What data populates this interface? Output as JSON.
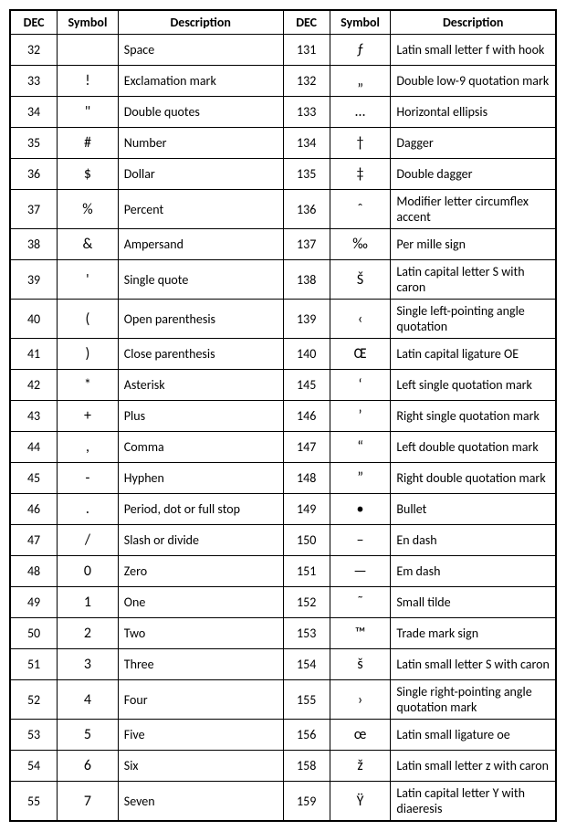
{
  "headers": {
    "dec": "DEC",
    "symbol": "Symbol",
    "description": "Description"
  },
  "rows": [
    {
      "l": {
        "dec": "32",
        "sym": "",
        "desc": "Space"
      },
      "r": {
        "dec": "131",
        "sym": "ƒ",
        "desc": "Latin small letter f with hook"
      }
    },
    {
      "l": {
        "dec": "33",
        "sym": "!",
        "desc": "Exclamation mark"
      },
      "r": {
        "dec": "132",
        "sym": "„",
        "desc": "Double low-9 quotation mark"
      }
    },
    {
      "l": {
        "dec": "34",
        "sym": "\"",
        "desc": "Double quotes"
      },
      "r": {
        "dec": "133",
        "sym": "…",
        "desc": "Horizontal ellipsis"
      }
    },
    {
      "l": {
        "dec": "35",
        "sym": "#",
        "desc": "Number"
      },
      "r": {
        "dec": "134",
        "sym": "†",
        "desc": "Dagger"
      }
    },
    {
      "l": {
        "dec": "36",
        "sym": "$",
        "desc": "Dollar"
      },
      "r": {
        "dec": "135",
        "sym": "‡",
        "desc": "Double dagger"
      }
    },
    {
      "l": {
        "dec": "37",
        "sym": "%",
        "desc": "Percent"
      },
      "r": {
        "dec": "136",
        "sym": "ˆ",
        "desc": "Modifier letter circumflex accent"
      }
    },
    {
      "l": {
        "dec": "38",
        "sym": "&",
        "desc": "Ampersand"
      },
      "r": {
        "dec": "137",
        "sym": "‰",
        "desc": "Per mille sign"
      }
    },
    {
      "l": {
        "dec": "39",
        "sym": "'",
        "desc": "Single quote"
      },
      "r": {
        "dec": "138",
        "sym": "Š",
        "desc": "Latin capital letter S with caron"
      }
    },
    {
      "l": {
        "dec": "40",
        "sym": "(",
        "desc": "Open parenthesis"
      },
      "r": {
        "dec": "139",
        "sym": "‹",
        "desc": "Single left-pointing angle quotation"
      }
    },
    {
      "l": {
        "dec": "41",
        "sym": ")",
        "desc": "Close parenthesis"
      },
      "r": {
        "dec": "140",
        "sym": "Œ",
        "desc": "Latin capital ligature OE"
      }
    },
    {
      "l": {
        "dec": "42",
        "sym": "*",
        "desc": "Asterisk"
      },
      "r": {
        "dec": "145",
        "sym": "‘",
        "desc": "Left single quotation mark"
      }
    },
    {
      "l": {
        "dec": "43",
        "sym": "+",
        "desc": "Plus"
      },
      "r": {
        "dec": "146",
        "sym": "’",
        "desc": "Right single quotation mark"
      }
    },
    {
      "l": {
        "dec": "44",
        "sym": ",",
        "desc": "Comma"
      },
      "r": {
        "dec": "147",
        "sym": "“",
        "desc": "Left double quotation mark"
      }
    },
    {
      "l": {
        "dec": "45",
        "sym": "-",
        "desc": "Hyphen"
      },
      "r": {
        "dec": "148",
        "sym": "”",
        "desc": "Right double quotation mark"
      }
    },
    {
      "l": {
        "dec": "46",
        "sym": ".",
        "desc": "Period, dot or full stop"
      },
      "r": {
        "dec": "149",
        "sym": "•",
        "desc": "Bullet"
      }
    },
    {
      "l": {
        "dec": "47",
        "sym": "/",
        "desc": "Slash or divide"
      },
      "r": {
        "dec": "150",
        "sym": "–",
        "desc": "En dash"
      }
    },
    {
      "l": {
        "dec": "48",
        "sym": "0",
        "desc": "Zero"
      },
      "r": {
        "dec": "151",
        "sym": "—",
        "desc": "Em dash"
      }
    },
    {
      "l": {
        "dec": "49",
        "sym": "1",
        "desc": "One"
      },
      "r": {
        "dec": "152",
        "sym": "˜",
        "desc": "Small tilde"
      }
    },
    {
      "l": {
        "dec": "50",
        "sym": "2",
        "desc": "Two"
      },
      "r": {
        "dec": "153",
        "sym": "™",
        "desc": "Trade mark sign"
      }
    },
    {
      "l": {
        "dec": "51",
        "sym": "3",
        "desc": "Three"
      },
      "r": {
        "dec": "154",
        "sym": "š",
        "desc": "Latin small letter S with caron"
      }
    },
    {
      "l": {
        "dec": "52",
        "sym": "4",
        "desc": "Four"
      },
      "r": {
        "dec": "155",
        "sym": "›",
        "desc": "Single right-pointing angle quotation mark"
      }
    },
    {
      "l": {
        "dec": "53",
        "sym": "5",
        "desc": "Five"
      },
      "r": {
        "dec": "156",
        "sym": "œ",
        "desc": "Latin small ligature oe"
      }
    },
    {
      "l": {
        "dec": "54",
        "sym": "6",
        "desc": "Six"
      },
      "r": {
        "dec": "158",
        "sym": "ž",
        "desc": "Latin small letter z with caron"
      }
    },
    {
      "l": {
        "dec": "55",
        "sym": "7",
        "desc": "Seven"
      },
      "r": {
        "dec": "159",
        "sym": "Ÿ",
        "desc": "Latin capital letter Y with diaeresis"
      }
    }
  ]
}
